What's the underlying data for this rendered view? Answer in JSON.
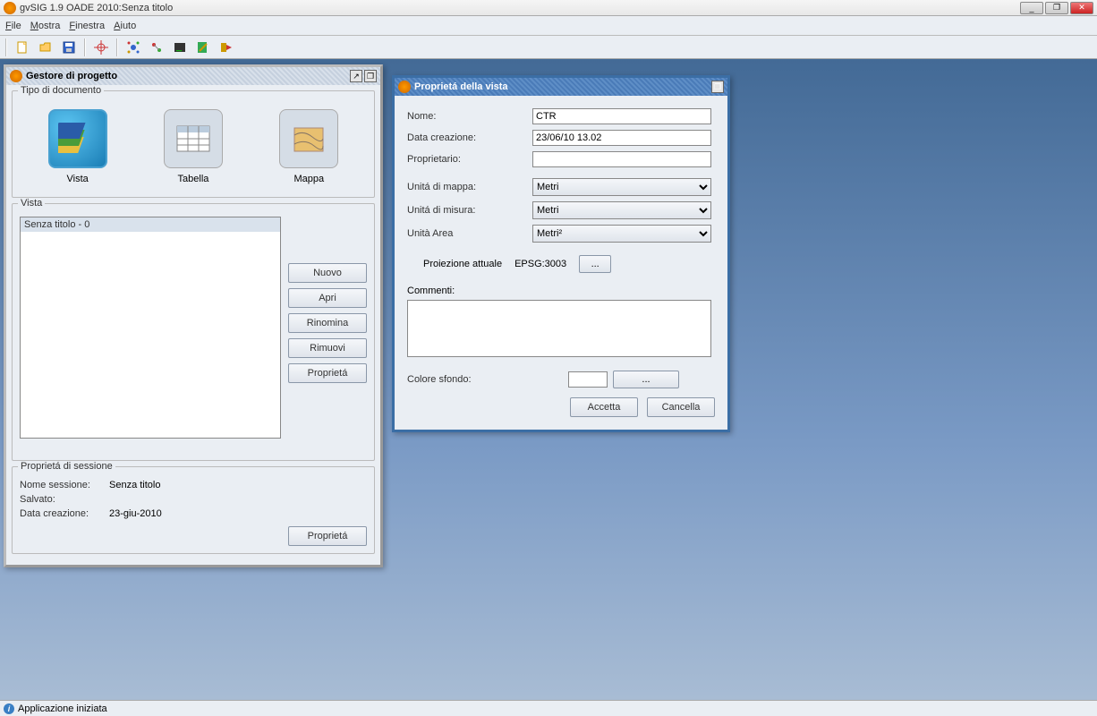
{
  "app": {
    "title": "gvSIG 1.9 OADE 2010:Senza titolo"
  },
  "menu": {
    "file": "File",
    "mostra": "Mostra",
    "finestra": "Finestra",
    "aiuto": "Aiuto"
  },
  "pm": {
    "title": "Gestore di progetto",
    "docType": "Tipo di documento",
    "vista": "Vista",
    "tabella": "Tabella",
    "mappa": "Mappa",
    "vistaGroup": "Vista",
    "listItem": "Senza titolo - 0",
    "nuovo": "Nuovo",
    "apri": "Apri",
    "rinomina": "Rinomina",
    "rimuovi": "Rimuovi",
    "proprieta": "Proprietá",
    "sessGroup": "Proprietá di sessione",
    "nomeSessLbl": "Nome sessione:",
    "nomeSessVal": "Senza titolo",
    "salvatoLbl": "Salvato:",
    "dataCreLbl": "Data creazione:",
    "dataCreVal": "23-giu-2010",
    "proprietaBtn": "Proprietá"
  },
  "vp": {
    "title": "Proprietá della vista",
    "nome": "Nome:",
    "nomeVal": "CTR",
    "dataCre": "Data creazione:",
    "dataCreVal": "23/06/10 13.02",
    "proprietario": "Proprietario:",
    "proprietarioVal": "",
    "unitaMappa": "Unitá di mappa:",
    "unitaMappaVal": "Metri",
    "unitaMisura": "Unitá di misura:",
    "unitaMisuraVal": "Metri",
    "unitaArea": "Unità Area",
    "unitaAreaVal": "Metri²",
    "proiezione": "Proiezione attuale",
    "proiezioneVal": "EPSG:3003",
    "ellipsis": "...",
    "commenti": "Commenti:",
    "coloreSfondo": "Colore sfondo:",
    "accetta": "Accetta",
    "cancella": "Cancella"
  },
  "status": {
    "text": "Applicazione iniziata"
  }
}
